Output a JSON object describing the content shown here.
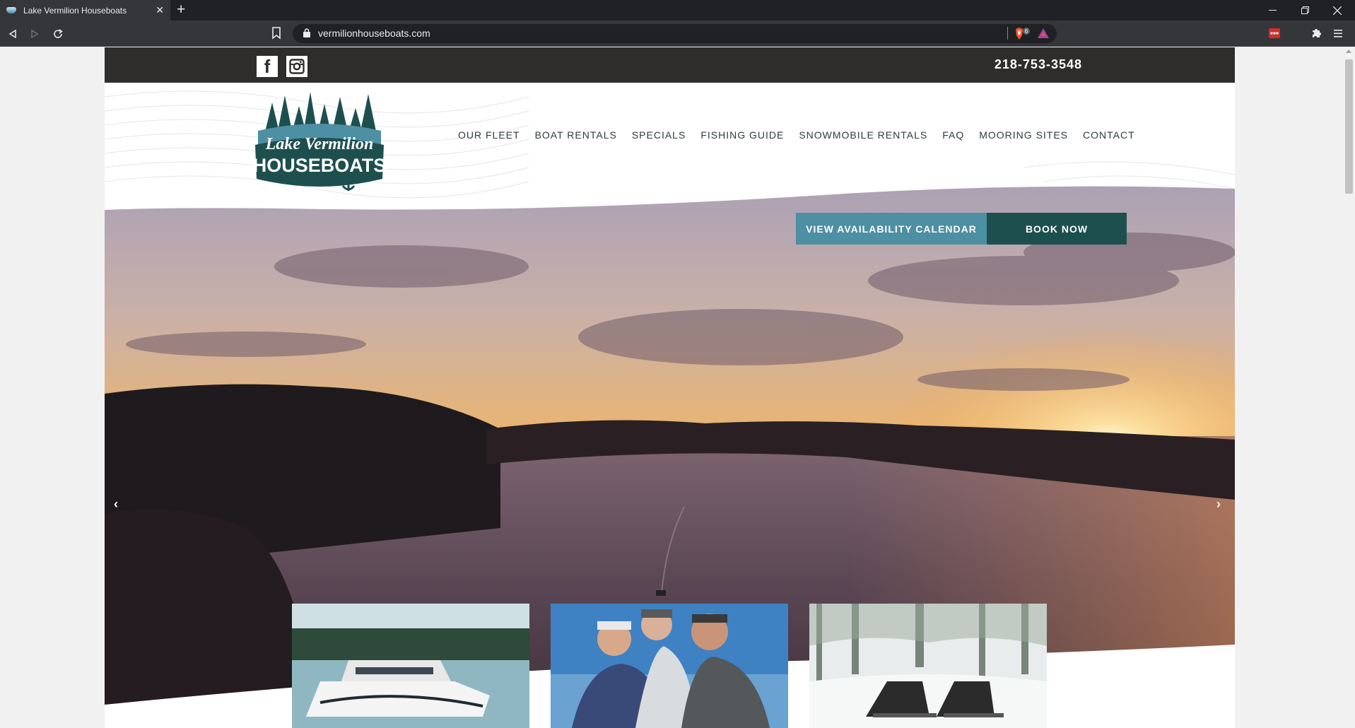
{
  "browser": {
    "tab_title": "Lake Vermilion Houseboats",
    "url": "vermilionhouseboats.com",
    "brave_badge": "6"
  },
  "topbar": {
    "phone": "218-753-3548",
    "social": [
      "facebook-icon",
      "instagram-icon"
    ]
  },
  "logo": {
    "line1": "Lake Vermilion",
    "line2": "HOUSEBOATS",
    "colors": {
      "teal": "#1e4f4f",
      "blue": "#4d8fa3"
    }
  },
  "nav": {
    "items": [
      "OUR FLEET",
      "BOAT RENTALS",
      "SPECIALS",
      "FISHING GUIDE",
      "SNOWMOBILE RENTALS",
      "FAQ",
      "MOORING SITES",
      "CONTACT"
    ]
  },
  "cta": {
    "calendar": "VIEW AVAILABILITY CALENDAR",
    "book": "BOOK NOW",
    "colors": {
      "calendar_bg": "#4d8fa3",
      "book_bg": "#1e4f4f"
    }
  },
  "hero": {
    "prev_arrow": "chevron-left-icon",
    "next_arrow": "chevron-right-icon"
  },
  "thumbnails": [
    "houseboat-photo",
    "fishing-guide-photo",
    "snowmobile-photo"
  ]
}
